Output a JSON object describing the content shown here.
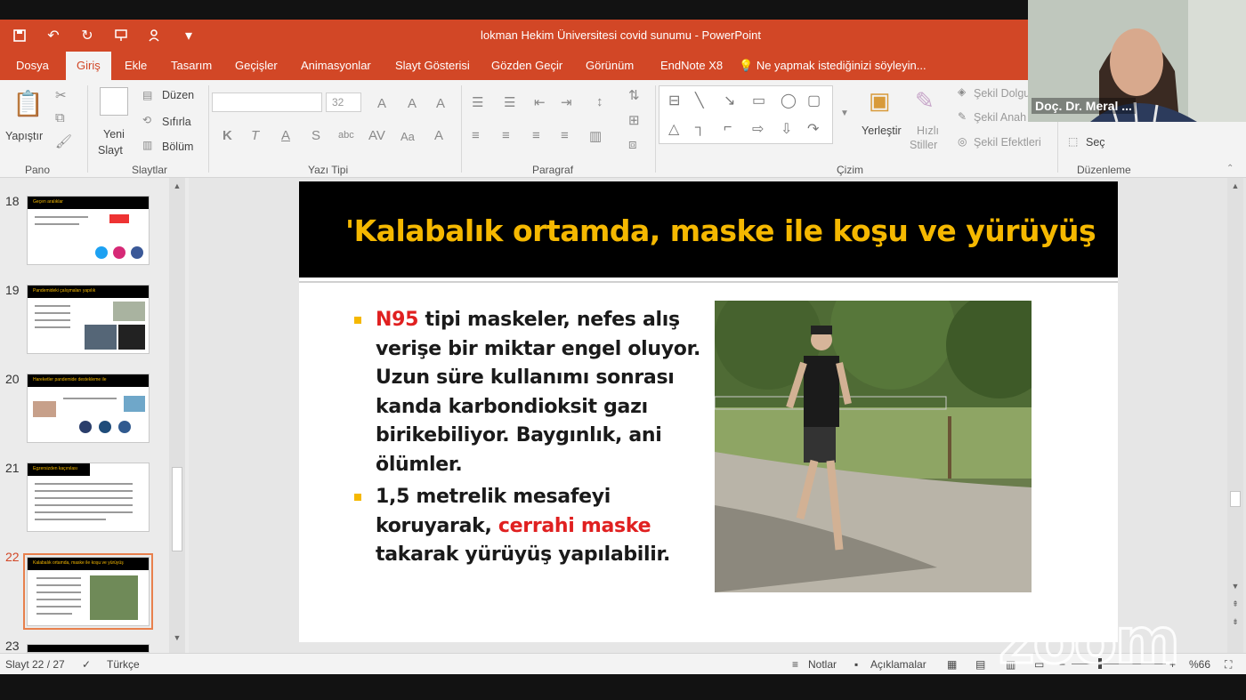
{
  "window": {
    "title": "lokman Hekim Üniversitesi covid sunumu - PowerPoint"
  },
  "ribbon_tabs": [
    "Dosya",
    "Giriş",
    "Ekle",
    "Tasarım",
    "Geçişler",
    "Animasyonlar",
    "Slayt Gösterisi",
    "Gözden Geçir",
    "Görünüm",
    "EndNote X8"
  ],
  "active_tab": "Giriş",
  "tell_me": "Ne yapmak istediğinizi söyleyin...",
  "ribbon": {
    "pano": {
      "label": "Pano",
      "paste": "Yapıştır"
    },
    "slaytlar": {
      "label": "Slaytlar",
      "new_slide": "Yeni",
      "new_slide2": "Slayt",
      "layout": "Düzen",
      "reset": "Sıfırla",
      "section": "Bölüm"
    },
    "yazi_tipi": {
      "label": "Yazı Tipi",
      "size": "32"
    },
    "paragraf": {
      "label": "Paragraf"
    },
    "cizim": {
      "label": "Çizim",
      "arrange": "Yerleştir",
      "quick_styles": "Hızlı",
      "quick_styles2": "Stiller",
      "shape_fill": "Şekil Dolgu",
      "shape_outline": "Şekil Anah",
      "shape_effects": "Şekil Efektleri"
    },
    "duzenleme": {
      "label": "Düzenleme",
      "select": "Seç"
    }
  },
  "thumbnails": [
    {
      "num": "18",
      "title": "Geçen aralıklar"
    },
    {
      "num": "19",
      "title": "Pandemideki çalışmaları yapılık"
    },
    {
      "num": "20",
      "title": "Hareketler pandemide destekleme ile"
    },
    {
      "num": "21",
      "title": "Egzersizden kaçınılası"
    },
    {
      "num": "22",
      "title": "Kalabalık ortamda, maske ile koşu ve yürüyüş"
    },
    {
      "num": "23",
      "title": ""
    }
  ],
  "slide": {
    "title": "'Kalabalık ortamda, maske ile koşu ve yürüyüş",
    "bullet1": {
      "highlight": "N95",
      "text": " tipi maskeler, nefes alış verişe bir miktar engel oluyor. Uzun süre kullanımı sonrası kanda karbondioksit gazı birikebiliyor. Baygınlık, ani ölümler."
    },
    "bullet2": {
      "pre": "1,5 metrelik mesafeyi koruyarak, ",
      "highlight": "cerrahi maske",
      "post": " takarak yürüyüş yapılabilir."
    }
  },
  "status": {
    "slide_counter": "Slayt 22 / 27",
    "language": "Türkçe",
    "notes": "Notlar",
    "comments": "Açıklamalar",
    "zoom": "%66"
  },
  "webcam": {
    "name": "Doç. Dr. Meral ..."
  },
  "watermark": "zoom",
  "colors": {
    "accent": "#d24726",
    "title_yellow": "#f5b800",
    "highlight_red": "#e02020"
  }
}
